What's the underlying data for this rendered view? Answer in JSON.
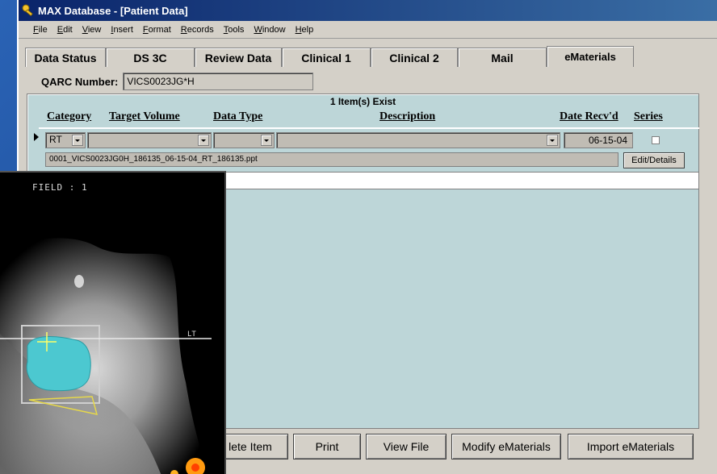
{
  "window": {
    "title": "MAX Database - [Patient Data]"
  },
  "menu": [
    "File",
    "Edit",
    "View",
    "Insert",
    "Format",
    "Records",
    "Tools",
    "Window",
    "Help"
  ],
  "tabs": [
    {
      "label": "Data Status"
    },
    {
      "label": "DS 3C"
    },
    {
      "label": "Review Data"
    },
    {
      "label": "Clinical 1"
    },
    {
      "label": "Clinical  2"
    },
    {
      "label": "Mail"
    },
    {
      "label": "eMaterials",
      "active": true
    }
  ],
  "qarc": {
    "label": "QARC Number:",
    "value": "VICS0023JG*H"
  },
  "items": {
    "count_text": "1 Item(s) Exist",
    "columns": {
      "category": "Category",
      "target_volume": "Target Volume",
      "data_type": "Data Type",
      "description": "Description",
      "date_recvd": "Date Recv'd",
      "series": "Series"
    },
    "row": {
      "category": "RT",
      "target_volume": "",
      "data_type": "",
      "description": "",
      "date_recvd": "06-15-04",
      "file_path": "0001_VICS0023JG0H_186135_06-15-04_RT_186135.ppt",
      "edit_label": "Edit/Details"
    }
  },
  "buttons": {
    "delete": "lete Item",
    "print": "Print",
    "view_file": "View File",
    "modify": "Modify eMaterials",
    "import": "Import eMaterials"
  },
  "overlay_image": {
    "field_label": "FIELD :  1",
    "lt_label": "LT"
  },
  "colors": {
    "titlebar": "#0a246a",
    "panel": "#bdd6d8",
    "background": "#1e4f9a",
    "tumor_fill": "#4cc8d0"
  }
}
